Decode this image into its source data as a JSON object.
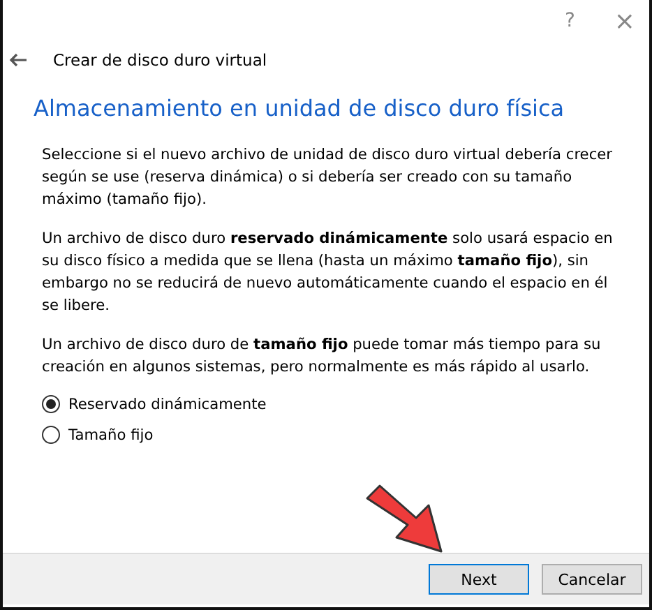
{
  "window": {
    "help": "?",
    "close": "×"
  },
  "header": {
    "title": "Crear de disco duro virtual"
  },
  "heading": "Almacenamiento en unidad de disco duro física",
  "paragraphs": [
    "Seleccione si el nuevo archivo de unidad de disco duro virtual debería crecer según se use (reserva dinámica) o si debería ser creado con su tamaño máximo (tamaño fijo).",
    "Un archivo de disco duro **reservado dinámicamente** solo usará espacio en su disco físico a medida que se llena (hasta un máximo **tamaño fijo**), sin embargo no se reducirá de nuevo automáticamente cuando el espacio en él se libere.",
    "Un archivo de disco duro de **tamaño fijo** puede tomar más tiempo para su creación en algunos sistemas, pero normalmente es más rápido al usarlo."
  ],
  "options": [
    {
      "label": "Reservado dinámicamente",
      "selected": true
    },
    {
      "label": "Tamaño fijo",
      "selected": false
    }
  ],
  "buttons": [
    {
      "label": "Next",
      "kind": "default"
    },
    {
      "label": "Cancelar",
      "kind": "normal"
    }
  ]
}
